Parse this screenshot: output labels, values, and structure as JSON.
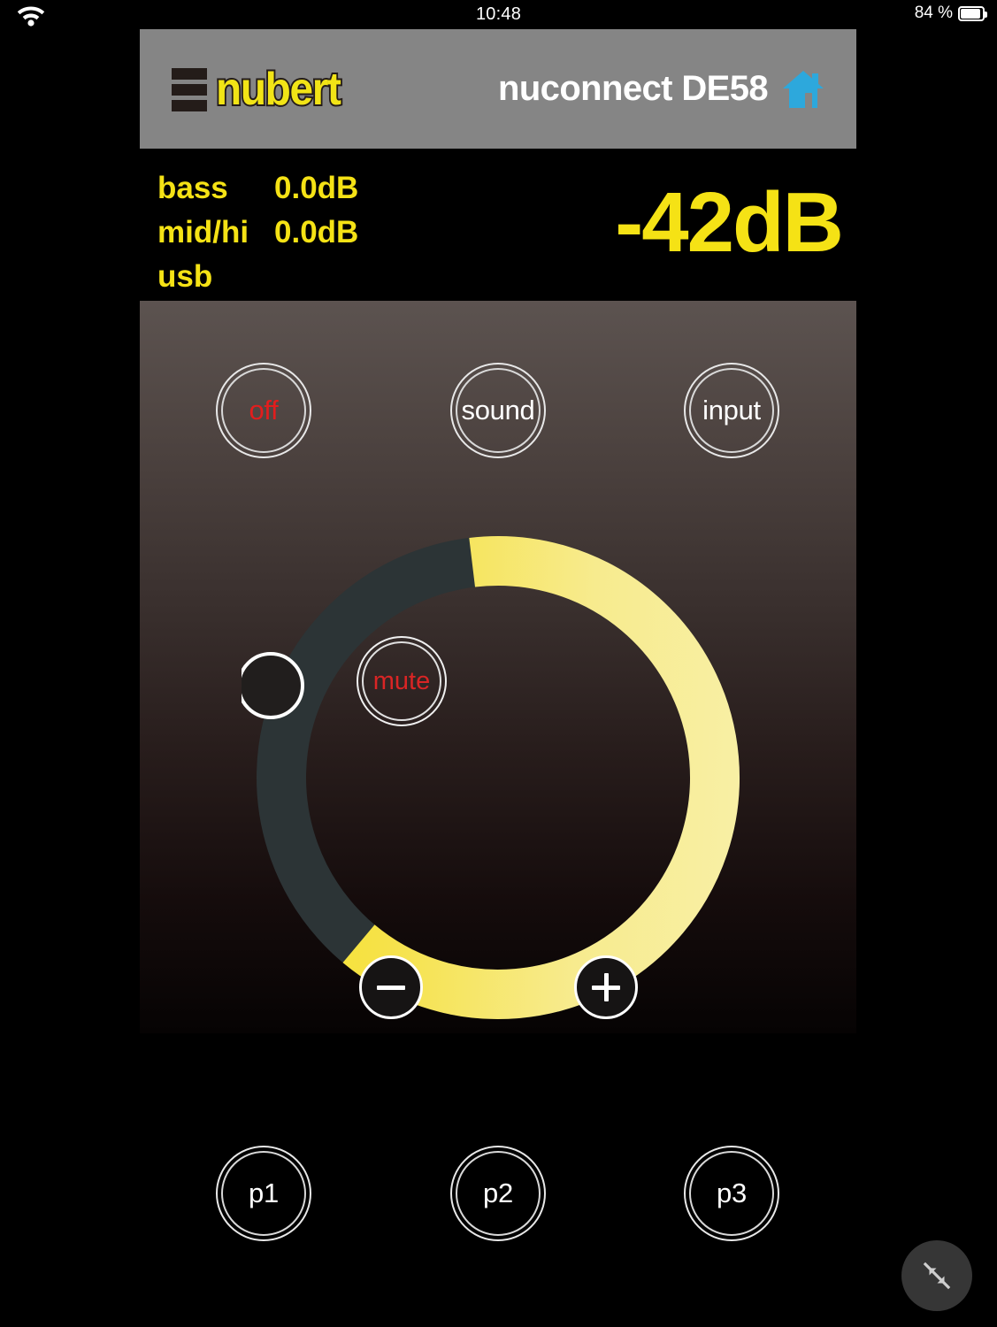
{
  "statusbar": {
    "wifi_icon": "wifi-icon",
    "time": "10:48",
    "battery_text": "84 %",
    "battery_icon": "battery-icon",
    "battery_percent": 84
  },
  "header": {
    "brand": "nubert",
    "brand_color": "#f2e416",
    "device_name": "nuconnect DE58",
    "home_icon": "home-icon",
    "home_icon_color": "#2da8dc",
    "background_color": "#858585"
  },
  "info": {
    "rows": [
      {
        "label": "bass",
        "value": "0.0dB"
      },
      {
        "label": "mid/hi",
        "value": "0.0dB"
      },
      {
        "label": "usb",
        "value": ""
      }
    ],
    "volume": "-42dB",
    "text_color": "#f5e215"
  },
  "controls": {
    "off_label": "off",
    "off_color": "#e21d1d",
    "sound_label": "sound",
    "input_label": "input",
    "mute_label": "mute",
    "mute_color": "#d92525",
    "minus_label": "−",
    "plus_label": "+"
  },
  "volume_ring": {
    "value_db": -42,
    "fill_percent": 63,
    "active_color": "#f5e528",
    "active_color_light": "#f7efa6",
    "track_color": "#2c3436",
    "handle_color": "#211e1d"
  },
  "presets": [
    {
      "label": "p1"
    },
    {
      "label": "p2"
    },
    {
      "label": "p3"
    }
  ],
  "fab": {
    "icon": "shrink-icon"
  }
}
